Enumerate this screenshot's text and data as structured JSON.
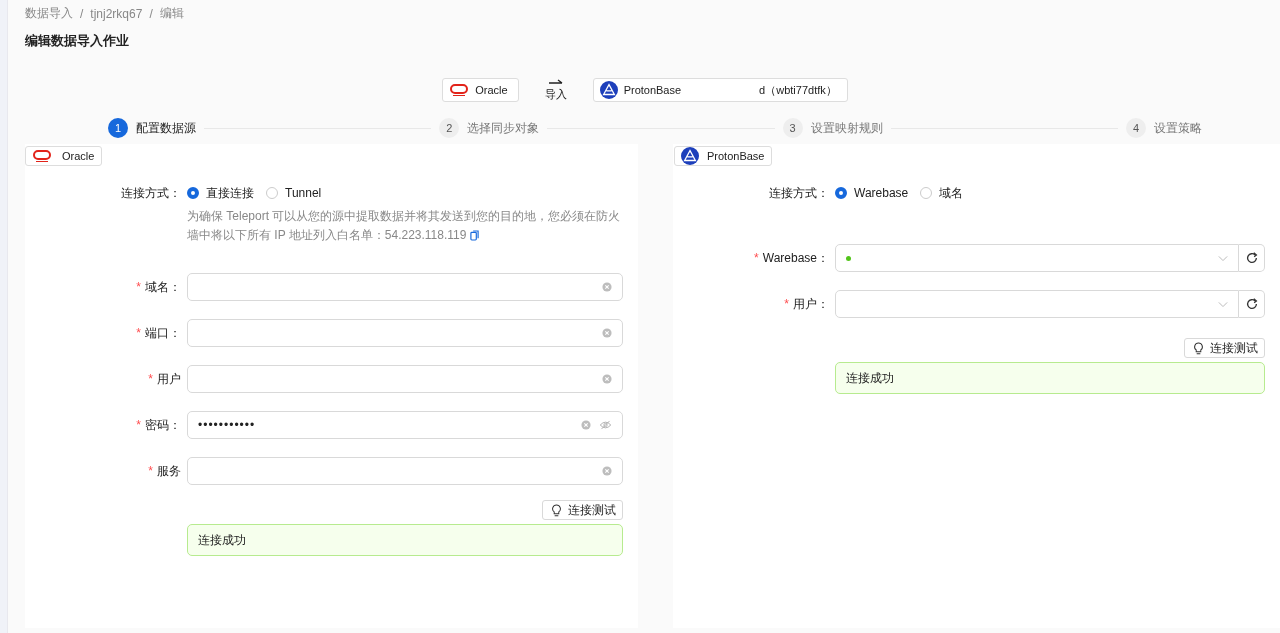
{
  "breadcrumb": {
    "separator": "/",
    "items": [
      "数据导入",
      "tjnj2rkq67",
      "编辑"
    ]
  },
  "title": "编辑数据导入作业",
  "flow": {
    "source": {
      "name": "Oracle",
      "kind": "oracle"
    },
    "arrow_label": "导入",
    "target": {
      "name": "ProtonBase",
      "kind": "protonbase",
      "suffix": "d（wbti77dtfk）"
    }
  },
  "steps": [
    {
      "number": "1",
      "label": "配置数据源",
      "selected": true
    },
    {
      "number": "2",
      "label": "选择同步对象",
      "selected": false
    },
    {
      "number": "3",
      "label": "设置映射规则",
      "selected": false
    },
    {
      "number": "4",
      "label": "设置策略",
      "selected": false
    }
  ],
  "panels": [
    {
      "badge": {
        "name": "Oracle",
        "kind": "oracle"
      },
      "connection": {
        "label": "连接方式：",
        "options": [
          {
            "label": "直接连接",
            "selected": true
          },
          {
            "label": "Tunnel",
            "selected": false
          }
        ]
      },
      "note": {
        "lines": [
          "为确保 Teleport 可以从您的源中提取数据并将其发送到您的目的地，您必须在防火",
          "墙中将以下所有 IP 地址列入白名单：54.223.118.119"
        ]
      },
      "fields": [
        {
          "required_mark": "*",
          "label": "域名：",
          "kind": "text"
        },
        {
          "required_mark": "*",
          "label": "端口：",
          "kind": "text"
        },
        {
          "required_mark": "*",
          "label": "用户",
          "kind": "text"
        },
        {
          "required_mark": "*",
          "label": "密码：",
          "kind": "password",
          "value": "•••••••••••"
        },
        {
          "required_mark": "*",
          "label": "服务",
          "kind": "text"
        }
      ],
      "test_button": "连接测试",
      "result": "连接成功"
    },
    {
      "badge": {
        "name": "ProtonBase",
        "kind": "protonbase"
      },
      "connection": {
        "label": "连接方式：",
        "options": [
          {
            "label": "Warebase",
            "selected": true
          },
          {
            "label": "域名",
            "selected": false
          }
        ]
      },
      "fields": [
        {
          "required_mark": "*",
          "label": "Warebase：",
          "kind": "select",
          "color": "#52c41a"
        },
        {
          "required_mark": "*",
          "label": "用户：",
          "kind": "select"
        }
      ],
      "test_button": "连接测试",
      "result": "连接成功"
    }
  ]
}
